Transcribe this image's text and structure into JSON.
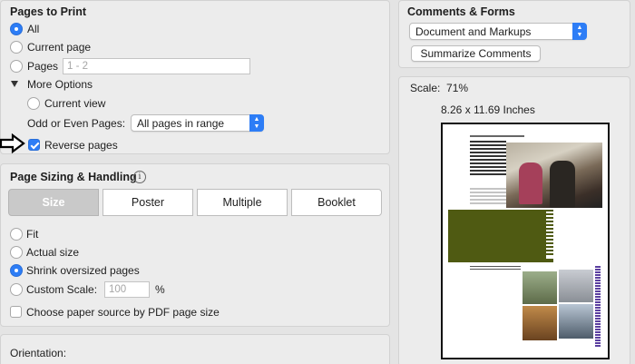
{
  "pages_to_print": {
    "title": "Pages to Print",
    "all_label": "All",
    "current_page_label": "Current page",
    "pages_label": "Pages",
    "pages_placeholder": "1 - 2",
    "more_options_label": "More Options",
    "current_view_label": "Current view",
    "odd_even_label": "Odd or Even Pages:",
    "odd_even_value": "All pages in range",
    "reverse_pages_label": "Reverse pages"
  },
  "page_sizing": {
    "title": "Page Sizing & Handling",
    "tabs": [
      "Size",
      "Poster",
      "Multiple",
      "Booklet"
    ],
    "fit_label": "Fit",
    "actual_size_label": "Actual size",
    "shrink_label": "Shrink oversized pages",
    "custom_scale_label": "Custom Scale:",
    "custom_scale_placeholder": "100",
    "percent_sign": "%",
    "paper_source_label": "Choose paper source by PDF page size"
  },
  "orientation": {
    "title": "Orientation:"
  },
  "comments_forms": {
    "title": "Comments & Forms",
    "select_value": "Document and Markups",
    "summarize_label": "Summarize Comments"
  },
  "preview": {
    "scale_label": "Scale:",
    "scale_value": "71%",
    "page_size": "8.26 x 11.69 Inches"
  },
  "colors": {
    "accent": "#2d7df6",
    "olive": "#4f5a12",
    "purple": "#5b3fa0"
  },
  "icons": [
    "info-icon",
    "disclosure-triangle-icon",
    "arrow-pointer-icon",
    "select-arrows-icon"
  ]
}
